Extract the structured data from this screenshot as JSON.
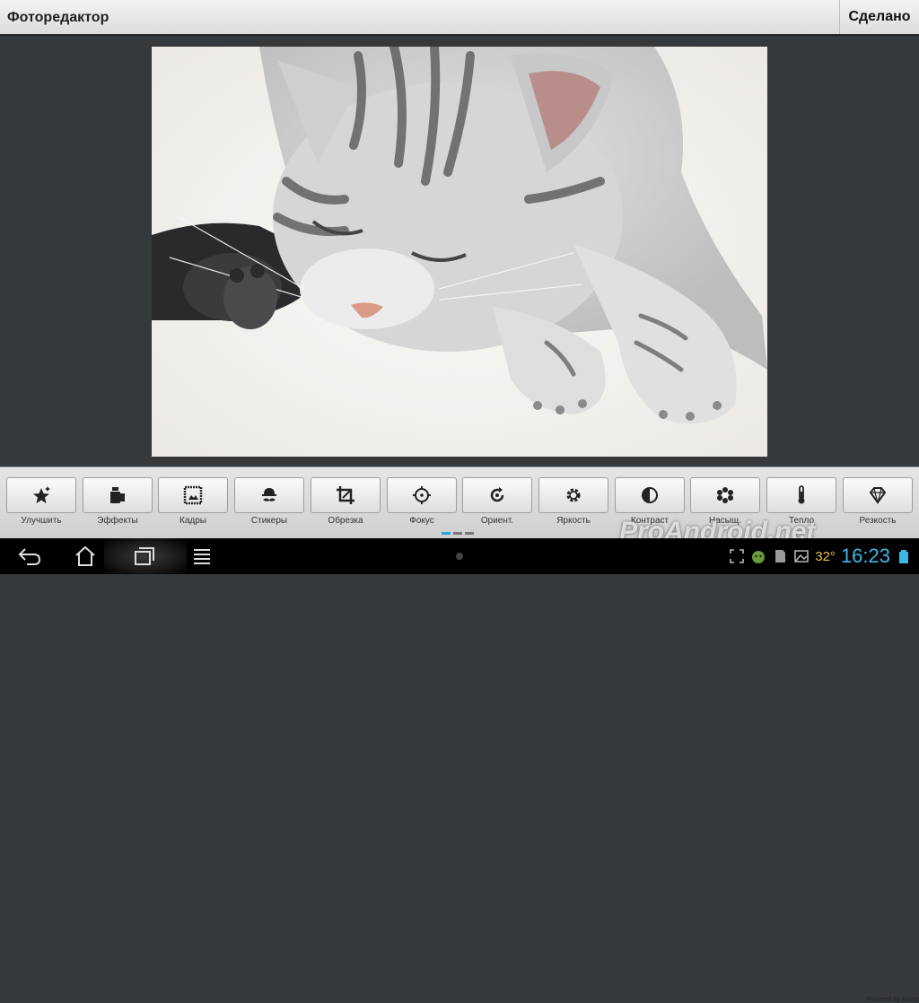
{
  "app": {
    "title": "Фоторедактор",
    "done_label": "Сделано"
  },
  "photo": {
    "subject": "sleeping-cat-photo"
  },
  "tools": [
    {
      "label": "Улучшить",
      "icon": "star-sparkle-icon"
    },
    {
      "label": "Эффекты",
      "icon": "effects-icon"
    },
    {
      "label": "Кадры",
      "icon": "frame-icon"
    },
    {
      "label": "Стикеры",
      "icon": "mustache-hat-icon"
    },
    {
      "label": "Обрезка",
      "icon": "crop-icon"
    },
    {
      "label": "Фокус",
      "icon": "focus-target-icon"
    },
    {
      "label": "Ориент.",
      "icon": "rotate-icon"
    },
    {
      "label": "Яркость",
      "icon": "sun-gear-icon"
    },
    {
      "label": "Контраст",
      "icon": "contrast-icon"
    },
    {
      "label": "Насыщ.",
      "icon": "flower-icon"
    },
    {
      "label": "Тепло",
      "icon": "thermometer-icon"
    },
    {
      "label": "Резкость",
      "icon": "diamond-icon"
    }
  ],
  "pager": {
    "pages": 3,
    "active": 0
  },
  "navbar": {
    "back_icon": "back-icon",
    "home_icon": "home-icon",
    "recents_icon": "recents-icon",
    "menu_icon": "menu-icon"
  },
  "status": {
    "temperature": "32°",
    "time": "16:23"
  },
  "watermark": "ProAndroid.net",
  "powered": "Powered by Aviary",
  "colors": {
    "accent": "#2aa4e0",
    "clock": "#3fb6e8",
    "temp": "#e8c239",
    "background": "#35393c"
  }
}
